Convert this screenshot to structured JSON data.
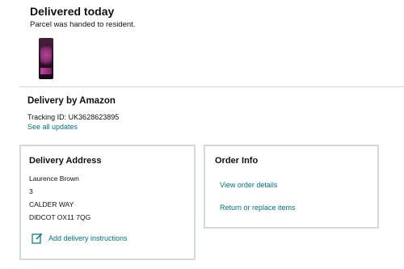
{
  "status": {
    "title": "Delivered today",
    "subtitle": "Parcel was handed to resident."
  },
  "product": {
    "thumbnail_icon": "product-pouch-image"
  },
  "carrier": {
    "title": "Delivery by Amazon",
    "tracking": "Tracking ID: UK3628623895",
    "see_updates": "See all updates"
  },
  "delivery_address": {
    "title": "Delivery Address",
    "lines": [
      "Laurence Brown",
      "3",
      "CALDER WAY",
      "DIDCOT OX11 7QG"
    ],
    "instructions_label": "Add delivery instructions",
    "instructions_icon": "edit-icon"
  },
  "order_info": {
    "title": "Order Info",
    "view_details": "View order details",
    "return_replace": "Return or replace items"
  },
  "colors": {
    "link": "#007185",
    "border": "#d5d9d9",
    "text": "#0f1111"
  }
}
